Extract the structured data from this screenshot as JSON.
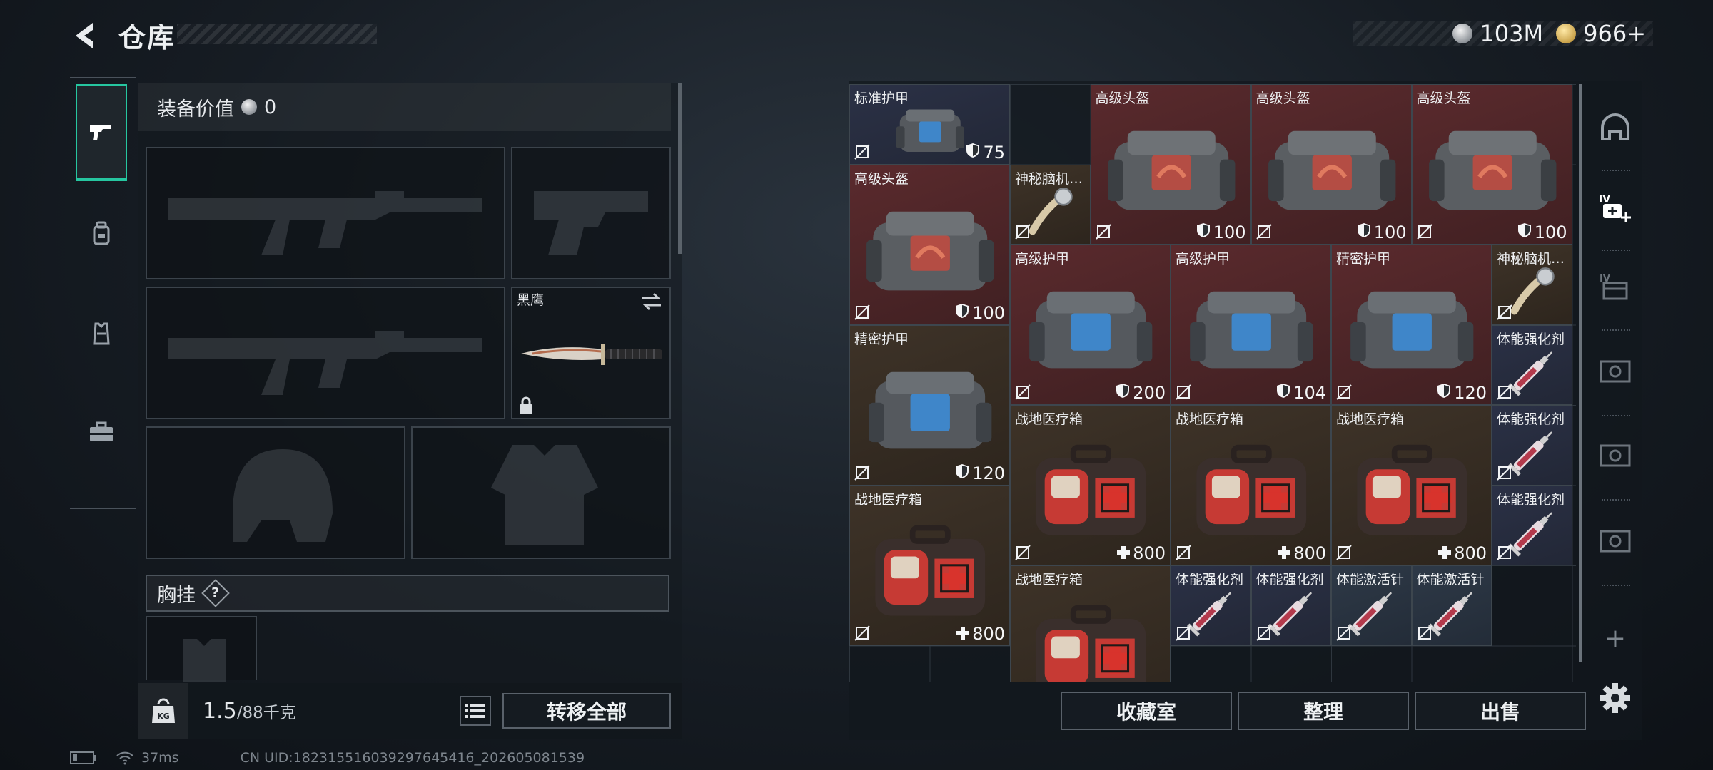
{
  "header": {
    "title": "仓库",
    "currency": [
      {
        "type": "silver",
        "amount": "103M"
      },
      {
        "type": "gold",
        "amount": "966+"
      }
    ]
  },
  "tabs": [
    {
      "icon": "pistol-icon",
      "active": true
    },
    {
      "icon": "backpack-icon",
      "active": false
    },
    {
      "icon": "vest-icon",
      "active": false
    },
    {
      "icon": "toolbox-icon",
      "active": false
    }
  ],
  "equipment": {
    "value_label": "装备价值",
    "value": "0",
    "melee": {
      "name": "黑鹰"
    },
    "chest_rig_label": "胸挂",
    "chest_rig_hint": "?",
    "weight_current": "1.5",
    "weight_max": "/88千克",
    "transfer_all": "转移全部"
  },
  "inventory": {
    "items": [
      {
        "name": "标准护甲",
        "value": "75",
        "kind": "armor",
        "bg": "blue"
      },
      {
        "name": "高级头盔",
        "value": "100",
        "kind": "helmet",
        "bg": "red"
      },
      {
        "name": "高级头盔",
        "value": "100",
        "kind": "helmet",
        "bg": "red"
      },
      {
        "name": "高级头盔",
        "value": "100",
        "kind": "helmet",
        "bg": "red"
      },
      {
        "name": "高级头盔",
        "value": "100",
        "kind": "helmet",
        "bg": "red"
      },
      {
        "name": "神秘脑机…",
        "value": "",
        "kind": "implant",
        "bg": "brown"
      },
      {
        "name": "高级护甲",
        "value": "200",
        "kind": "armor",
        "bg": "red"
      },
      {
        "name": "高级护甲",
        "value": "104",
        "kind": "armor",
        "bg": "red"
      },
      {
        "name": "精密护甲",
        "value": "120",
        "kind": "armor",
        "bg": "red"
      },
      {
        "name": "神秘脑机…",
        "value": "",
        "kind": "implant",
        "bg": "brown"
      },
      {
        "name": "精密护甲",
        "value": "120",
        "kind": "armor",
        "bg": "brown"
      },
      {
        "name": "体能强化剂",
        "value": "",
        "kind": "syringe",
        "bg": "blue"
      },
      {
        "name": "战地医疗箱",
        "value": "800",
        "kind": "medkit",
        "bg": "brown"
      },
      {
        "name": "战地医疗箱",
        "value": "800",
        "kind": "medkit",
        "bg": "brown"
      },
      {
        "name": "战地医疗箱",
        "value": "800",
        "kind": "medkit",
        "bg": "brown"
      },
      {
        "name": "体能强化剂",
        "value": "",
        "kind": "syringe",
        "bg": "blue"
      },
      {
        "name": "战地医疗箱",
        "value": "800",
        "kind": "medkit",
        "bg": "brown"
      },
      {
        "name": "体能强化剂",
        "value": "",
        "kind": "syringe",
        "bg": "blue"
      },
      {
        "name": "战地医疗箱",
        "value": "",
        "kind": "medkit",
        "bg": "brown"
      },
      {
        "name": "体能强化剂",
        "value": "",
        "kind": "syringe",
        "bg": "blue"
      },
      {
        "name": "体能强化剂",
        "value": "",
        "kind": "syringe",
        "bg": "blue"
      },
      {
        "name": "体能激活针",
        "value": "",
        "kind": "syringe",
        "bg": "bluegray"
      },
      {
        "name": "体能激活针",
        "value": "",
        "kind": "syringe",
        "bg": "bluegray"
      }
    ],
    "buttons": {
      "collection": "收藏室",
      "organize": "整理",
      "sell": "出售"
    }
  },
  "side_icons": [
    "helmet-slot-icon",
    "add-medical-slot-icon",
    "container-slot-icon",
    "case-slot-icon",
    "case-slot-icon",
    "case-slot-icon",
    "plus-icon",
    "settings-icon"
  ],
  "side_text": {
    "add": "+"
  },
  "status": {
    "ping": "37ms",
    "uid": "CN UID:18231551603929764​5416_202605081539"
  }
}
